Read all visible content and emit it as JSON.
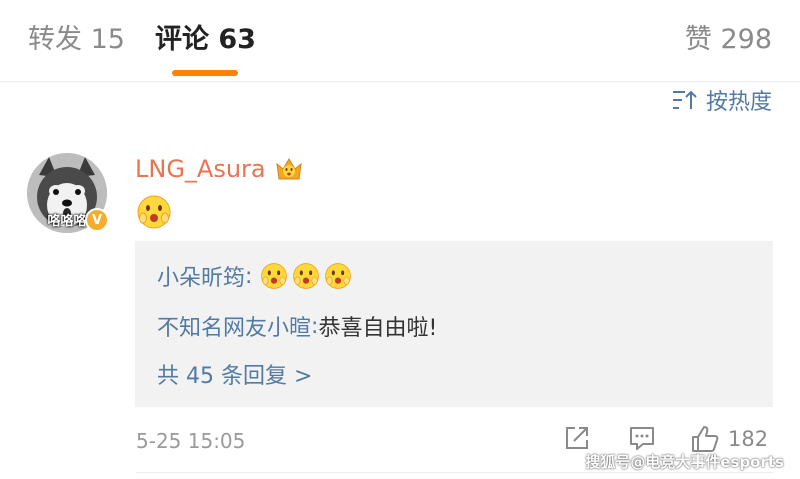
{
  "tabs": {
    "repost_label": "转发 15",
    "comments_label": "评论 63",
    "likes_label": "赞 298"
  },
  "sort": {
    "label": "按热度",
    "icon": "sort-icon"
  },
  "comment": {
    "avatar_caption": "咯咯咯",
    "verified_label": "V",
    "username": "LNG_Asura",
    "badge_icon": "crown-vip-icon",
    "content_emoji": "surprised-face-emoji",
    "replies": [
      {
        "user": "小朵昕筠",
        "separator": ": ",
        "emojis": [
          "surprised-face-emoji",
          "surprised-face-emoji",
          "surprised-face-emoji"
        ]
      },
      {
        "user": "不知名网友小暄",
        "separator": ": ",
        "text": "恭喜自由啦!"
      }
    ],
    "more_replies": "共 45 条回复 >",
    "timestamp": "5-25 15:05",
    "like_count": "182"
  },
  "watermark": "搜狐号@电竞大事件esports",
  "colors": {
    "accent": "#ff8200",
    "username": "#eb7350",
    "link": "#527aa3",
    "muted": "#8a8a8a"
  }
}
